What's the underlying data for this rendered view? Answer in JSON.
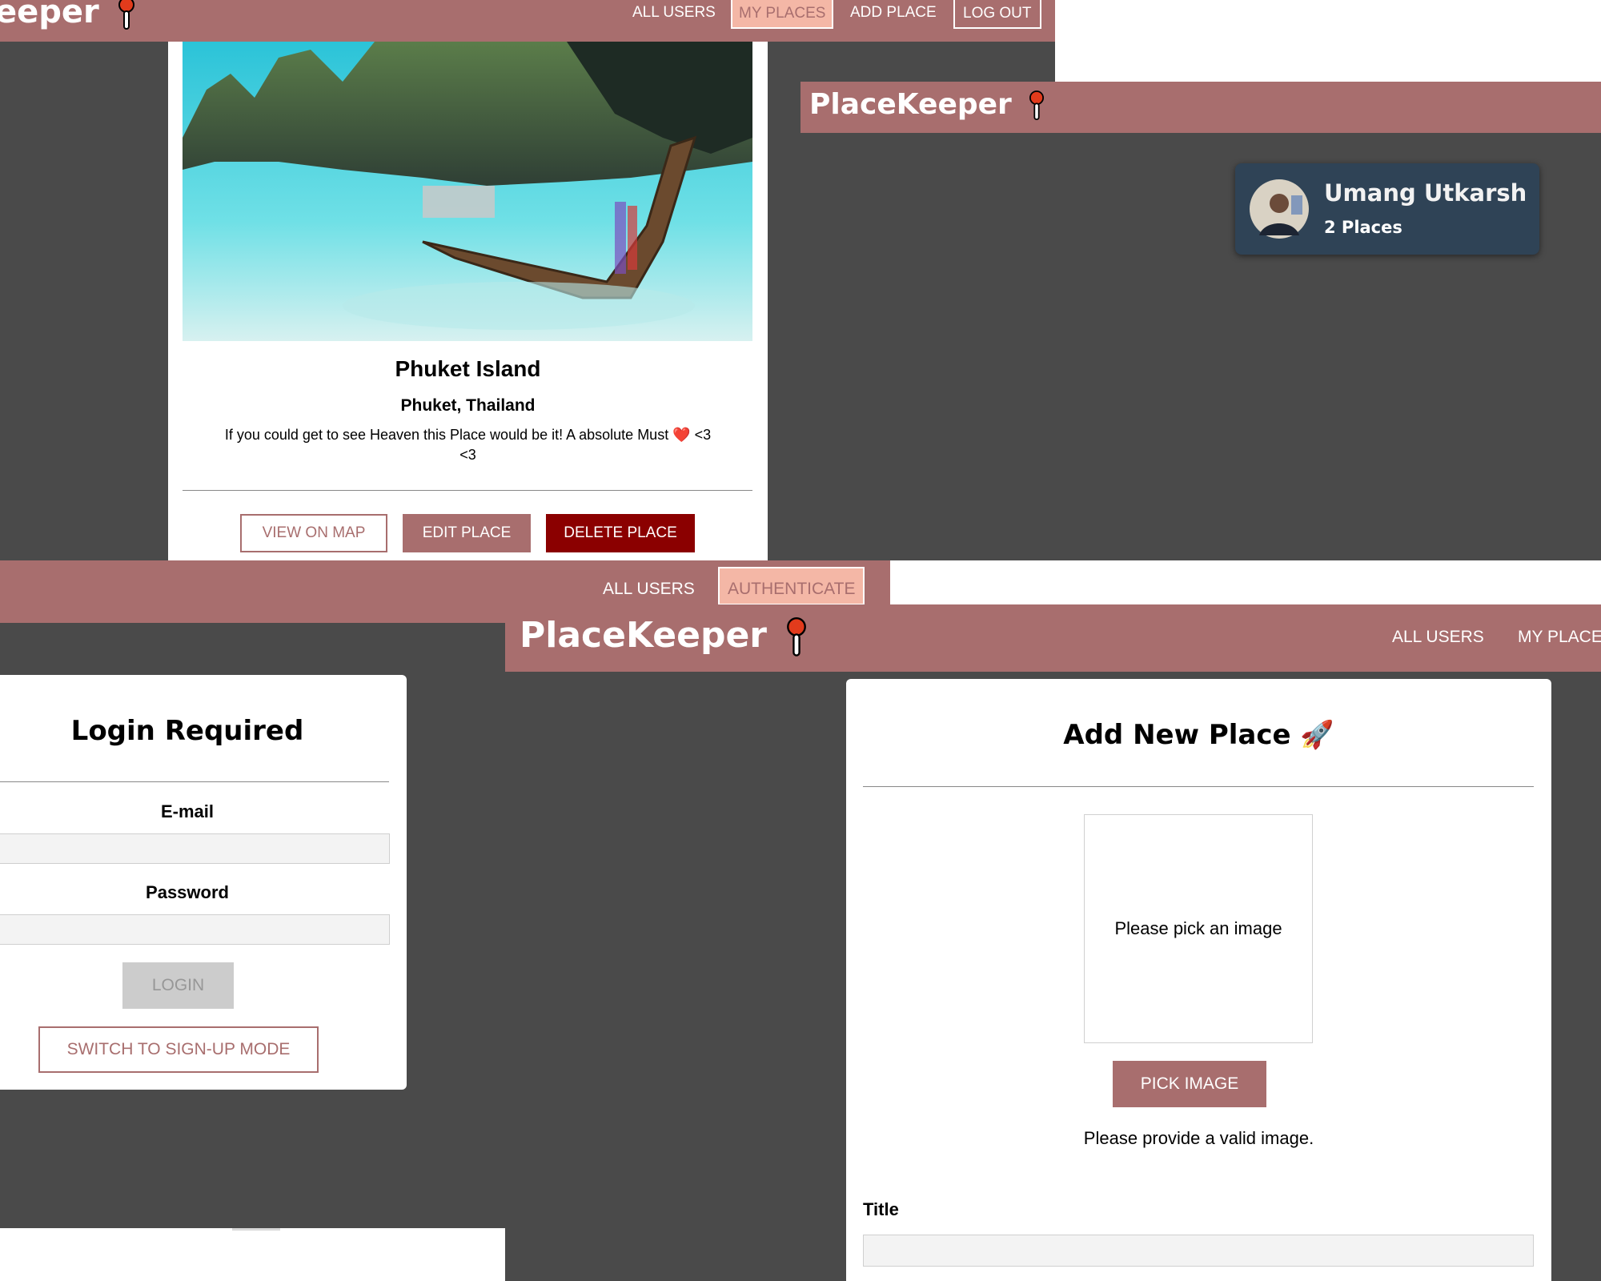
{
  "brand": {
    "name": "PlaceKeeper",
    "clipped_name": "eeper"
  },
  "panel_place": {
    "nav": {
      "all_users": "ALL USERS",
      "my_places": "MY PLACES",
      "add_place": "ADD PLACE",
      "logout": "LOG OUT"
    },
    "place": {
      "title": "Phuket Island",
      "address": "Phuket, Thailand",
      "description_line1": "If you could get to see Heaven this Place would be it! A absolute Must ❤️ <3",
      "description_line2": "<3",
      "view_on_map": "VIEW ON MAP",
      "edit": "EDIT PLACE",
      "delete": "DELETE PLACE"
    }
  },
  "panel_users": {
    "user": {
      "name": "Umang Utkarsh",
      "places": "2 Places"
    }
  },
  "panel_auth": {
    "nav": {
      "all_users": "ALL USERS",
      "authenticate": "AUTHENTICATE"
    },
    "title": "Login Required",
    "email_label": "E-mail",
    "password_label": "Password",
    "login": "LOGIN",
    "switch": "SWITCH TO SIGN-UP MODE"
  },
  "panel_new": {
    "nav": {
      "all_users": "ALL USERS",
      "my_places": "MY PLACE"
    },
    "title": "Add New Place 🚀",
    "image_placeholder": "Please pick an image",
    "pick_image": "PICK IMAGE",
    "error": "Please provide a valid image.",
    "title_label": "Title"
  },
  "colors": {
    "header": "#a86e6e",
    "bg": "#4a4a4a",
    "danger": "#8b0000",
    "active_tab": "#f4b7a6",
    "user_card": "#2f4356"
  }
}
